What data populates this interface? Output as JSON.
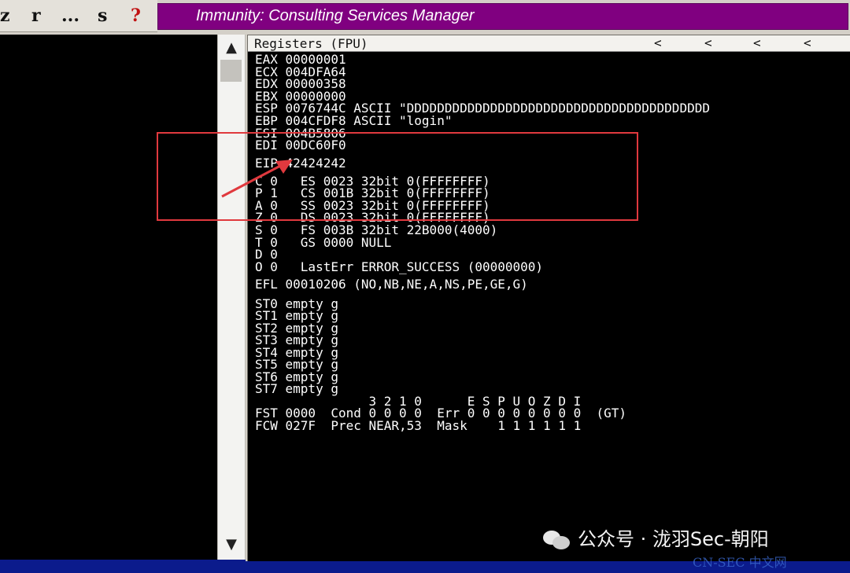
{
  "toolbar": {
    "buttons": [
      "z",
      "r",
      "...",
      "s",
      "?"
    ]
  },
  "window": {
    "title": "Immunity: Consulting Services Manager"
  },
  "registers_pane": {
    "header": "Registers (FPU)",
    "header_arrows": [
      "<",
      "<",
      "<",
      "<"
    ],
    "lines": [
      "EAX 00000001",
      "ECX 004DFA64",
      "EDX 00000358",
      "EBX 00000000",
      "ESP 0076744C ASCII \"DDDDDDDDDDDDDDDDDDDDDDDDDDDDDDDDDDDDDDDD",
      "EBP 004CFDF8 ASCII \"login\"",
      "ESI 004B5806",
      "EDI 00DC60F0",
      "EIP 42424242",
      "C 0   ES 0023 32bit 0(FFFFFFFF)",
      "P 1   CS 001B 32bit 0(FFFFFFFF)",
      "A 0   SS 0023 32bit 0(FFFFFFFF)",
      "Z 0   DS 0023 32bit 0(FFFFFFFF)",
      "S 0   FS 003B 32bit 22B000(4000)",
      "T 0   GS 0000 NULL",
      "D 0",
      "O 0   LastErr ERROR_SUCCESS (00000000)",
      "EFL 00010206 (NO,NB,NE,A,NS,PE,GE,G)",
      "ST0 empty g",
      "ST1 empty g",
      "ST2 empty g",
      "ST3 empty g",
      "ST4 empty g",
      "ST5 empty g",
      "ST6 empty g",
      "ST7 empty g",
      "               3 2 1 0      E S P U O Z D I",
      "FST 0000  Cond 0 0 0 0  Err 0 0 0 0 0 0 0 0  (GT)",
      "FCW 027F  Prec NEAR,53  Mask    1 1 1 1 1 1"
    ]
  },
  "scrollbar": {
    "up": "^",
    "down": "v"
  },
  "watermark": {
    "text": "公众号 · 泷羽Sec-朝阳",
    "sub": "CN-SEC 中文网"
  },
  "colors": {
    "title_bar": "#800080",
    "highlight": "#e0393e",
    "status_bar": "#0b1b8c"
  }
}
